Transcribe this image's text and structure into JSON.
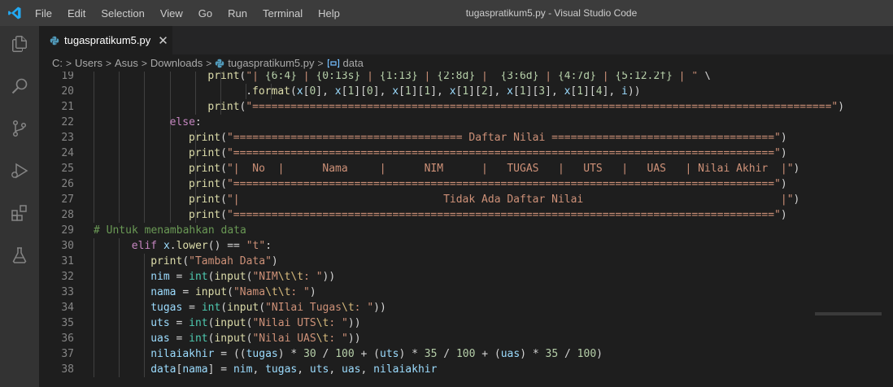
{
  "window": {
    "title": "tugaspratikum5.py - Visual Studio Code",
    "menu": [
      "File",
      "Edit",
      "Selection",
      "View",
      "Go",
      "Run",
      "Terminal",
      "Help"
    ]
  },
  "activity_bar": [
    "files-icon",
    "search-icon",
    "source-control-icon",
    "run-debug-icon",
    "extensions-icon",
    "testing-icon"
  ],
  "tab": {
    "filename": "tugaspratikum5.py",
    "close": "✕"
  },
  "breadcrumb": {
    "items": [
      "C:",
      "Users",
      "Asus",
      "Downloads",
      "tugaspratikum5.py",
      "data"
    ],
    "separator": ">"
  },
  "editor": {
    "lines": [
      {
        "n": "19",
        "indent": 6,
        "text": "print(\"| {6:4} | {0:13s} | {1:13} | {2:8d} |  {3:6d} | {4:7d} | {5:12.2f} | \" \\"
      },
      {
        "n": "20",
        "indent": 8,
        "text": ".format(x[0], x[1][0], x[1][1], x[1][2], x[1][3], x[1][4], i))"
      },
      {
        "n": "21",
        "indent": 6,
        "text": "print(\"===========================================================================================\")"
      },
      {
        "n": "22",
        "indent": 4,
        "text": "else:"
      },
      {
        "n": "23",
        "indent": 5,
        "text": "print(\"==================================== Daftar Nilai ===================================\")"
      },
      {
        "n": "24",
        "indent": 5,
        "text": "print(\"=====================================================================================\")"
      },
      {
        "n": "25",
        "indent": 5,
        "text": "print(\"|  No  |      Nama     |      NIM      |   TUGAS   |   UTS   |   UAS   | Nilai Akhir  |\")"
      },
      {
        "n": "26",
        "indent": 5,
        "text": "print(\"=====================================================================================\")"
      },
      {
        "n": "27",
        "indent": 5,
        "text": "print(\"|                                Tidak Ada Daftar Nilai                               |\")"
      },
      {
        "n": "28",
        "indent": 5,
        "text": "print(\"=====================================================================================\")"
      },
      {
        "n": "29",
        "indent": 0,
        "text": "# Untuk menambahkan data"
      },
      {
        "n": "30",
        "indent": 2,
        "text": "elif x.lower() == \"t\":"
      },
      {
        "n": "31",
        "indent": 3,
        "text": "print(\"Tambah Data\")"
      },
      {
        "n": "32",
        "indent": 3,
        "text": "nim = int(input(\"NIM\\t\\t: \"))"
      },
      {
        "n": "33",
        "indent": 3,
        "text": "nama = input(\"Nama\\t\\t: \")"
      },
      {
        "n": "34",
        "indent": 3,
        "text": "tugas = int(input(\"NIlai Tugas\\t: \"))"
      },
      {
        "n": "35",
        "indent": 3,
        "text": "uts = int(input(\"Nilai UTS\\t: \"))"
      },
      {
        "n": "36",
        "indent": 3,
        "text": "uas = int(input(\"Nilai UAS\\t: \"))"
      },
      {
        "n": "37",
        "indent": 3,
        "text": "nilaiakhir = ((tugas) * 30 / 100 + (uts) * 35 / 100 + (uas) * 35 / 100)"
      },
      {
        "n": "38",
        "indent": 3,
        "text": "data[nama] = nim, tugas, uts, uas, nilaiakhir"
      }
    ]
  },
  "colors": {
    "titlebar": "#3c3c3c",
    "activitybar": "#333333",
    "editor_bg": "#1e1e1e",
    "keyword": "#c586c0",
    "function": "#dcdcaa",
    "string": "#ce9178",
    "number": "#b5cea8",
    "comment": "#6a9955",
    "variable": "#9cdcfe",
    "vscode_blue": "#23a9f2"
  }
}
